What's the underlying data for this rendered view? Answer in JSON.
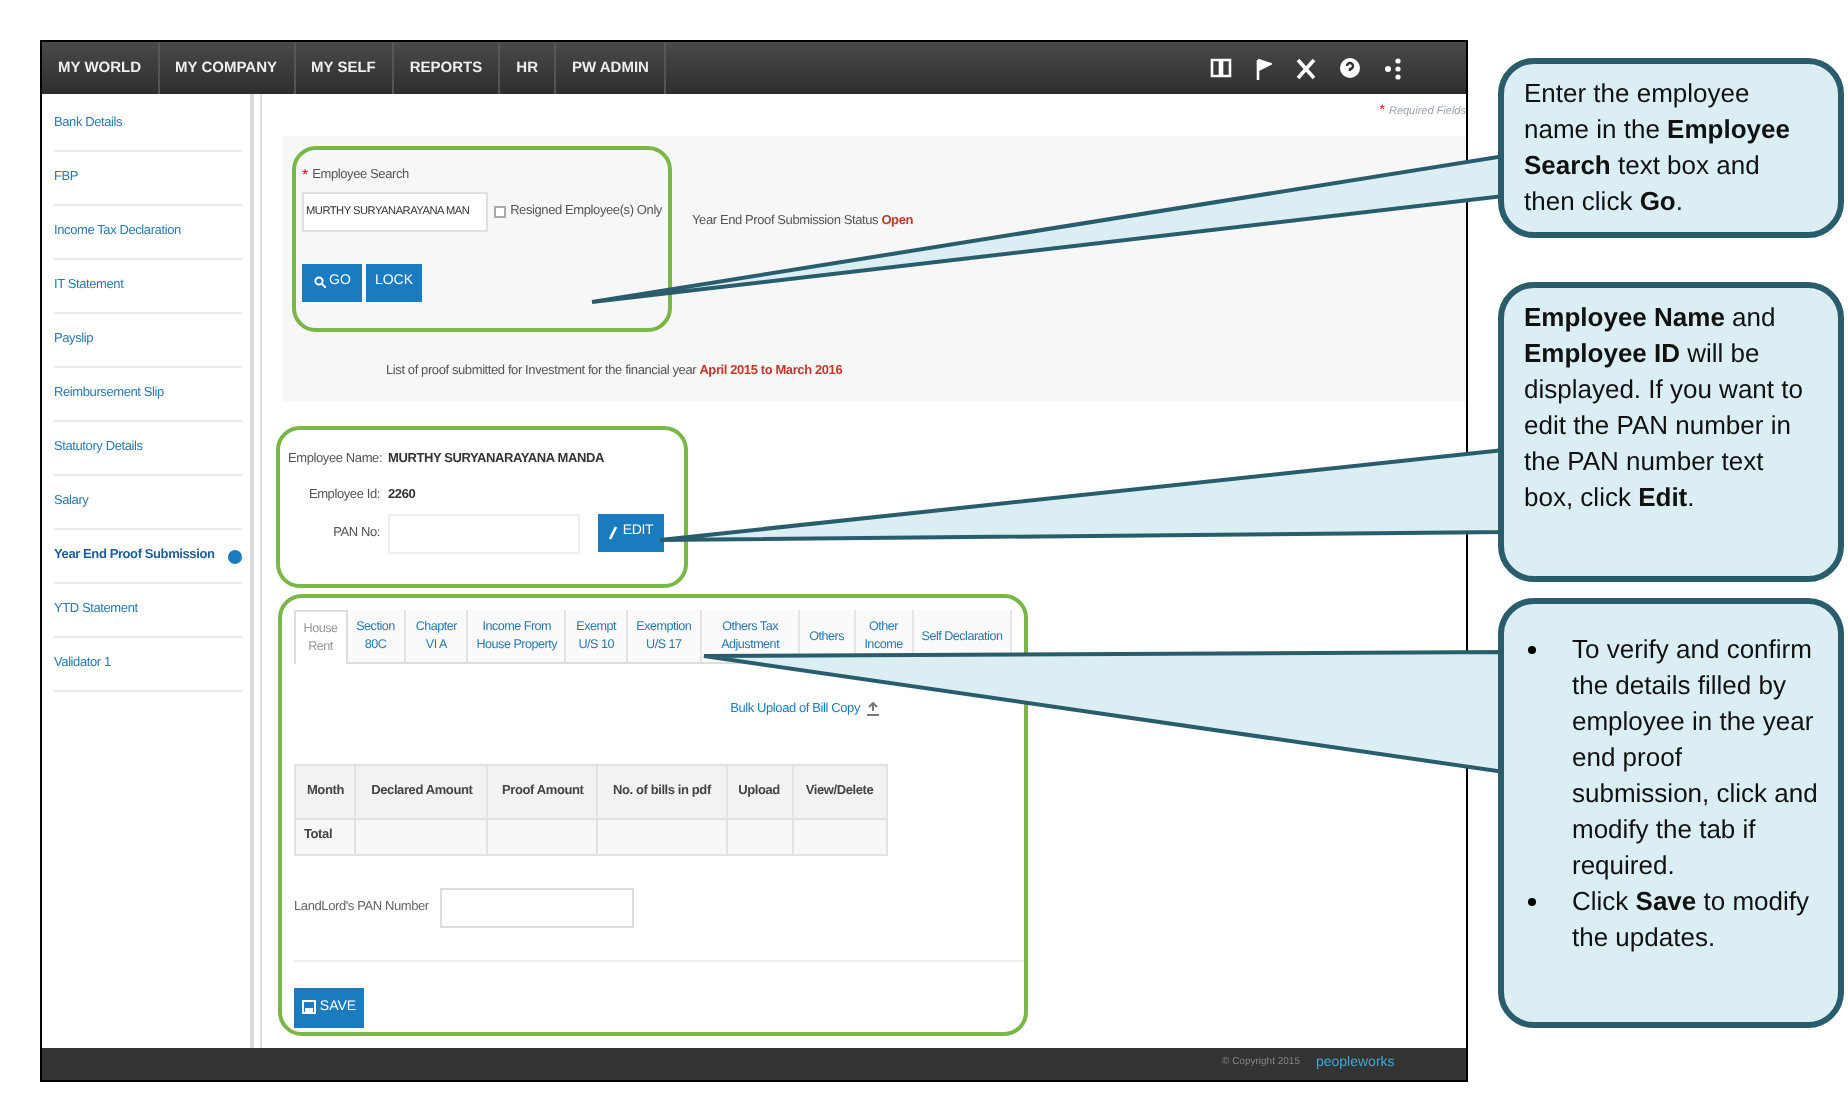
{
  "nav": {
    "items": [
      {
        "label": "MY WORLD",
        "selected": false
      },
      {
        "label": "MY COMPANY",
        "selected": false
      },
      {
        "label": "MY SELF",
        "selected": false
      },
      {
        "label": "REPORTS",
        "selected": false
      },
      {
        "label": "HR",
        "selected": false
      },
      {
        "label": "PW ADMIN",
        "selected": false
      }
    ]
  },
  "sidebar": {
    "items": [
      {
        "label": "Bank Details",
        "selected": false
      },
      {
        "label": "FBP",
        "selected": false
      },
      {
        "label": "Income Tax Declaration",
        "selected": false
      },
      {
        "label": "IT Statement",
        "selected": false
      },
      {
        "label": "Payslip",
        "selected": false
      },
      {
        "label": "Reimbursement Slip",
        "selected": false
      },
      {
        "label": "Statutory Details",
        "selected": false
      },
      {
        "label": "Salary",
        "selected": false
      },
      {
        "label": "Year End Proof Submission",
        "selected": true
      },
      {
        "label": "YTD Statement",
        "selected": false
      },
      {
        "label": "Validator 1",
        "selected": false
      }
    ]
  },
  "required_note": {
    "mark": "*",
    "text": "Required Fields"
  },
  "search": {
    "required_mark": "*",
    "label": "Employee Search",
    "value": "MURTHY SURYANARAYANA MAN",
    "resigned": {
      "label": "Resigned Employee(s) Only",
      "checked": false
    },
    "status_label": "Year End Proof Submission Status",
    "status_value": "Open",
    "buttons": [
      "GO",
      "LOCK"
    ],
    "note": "List of proof submitted for Investment for the financial year **April 2015 to March 2016**"
  },
  "employee": {
    "name_label": "Employee Name:",
    "name": "MURTHY SURYANARAYANA MANDA",
    "id_label": "Employee Id:",
    "id": "2260",
    "pan_label": "PAN No:",
    "edit_button": "EDIT"
  },
  "tabs": [
    {
      "label": "House Rent",
      "selected": true
    },
    {
      "label": "Section 80C",
      "selected": false
    },
    {
      "label": "Chapter VI A",
      "selected": false
    },
    {
      "label": "Income From House Property",
      "selected": false
    },
    {
      "label": "Exempt U/S 10",
      "selected": false
    },
    {
      "label": "Exemption U/S 17",
      "selected": false
    },
    {
      "label": "Others Tax Adjustment",
      "selected": false
    },
    {
      "label": "Others",
      "selected": false
    },
    {
      "label": "Other Income",
      "selected": false
    },
    {
      "label": "Self Declaration",
      "selected": false
    }
  ],
  "bulk_upload": "Bulk Upload of Bill Copy",
  "table": {
    "columns": [
      "Month",
      "Declared Amount",
      "Proof Amount",
      "No. of bills in pdf",
      "Upload",
      "View/Delete"
    ],
    "rows": [
      [
        "Total"
      ]
    ]
  },
  "landlord_pan_label": "LandLord's PAN Number",
  "save_button": "SAVE",
  "footer": {
    "copyright": "© Copyright 2015",
    "logo": "peopleworks"
  },
  "callouts": [
    {
      "kind": "text",
      "text": "Enter the employee name in the **Employee Search** text box and then click **Go**."
    },
    {
      "kind": "text",
      "text": "**Employee Name** and **Employee ID** will be displayed. If you want to edit the PAN number in the PAN number text box, click **Edit**."
    },
    {
      "kind": "bullets",
      "items": [
        "To verify and confirm the details filled by employee in the year end proof submission, click and modify the tab if required.",
        "Click **Save** to modify the updates."
      ]
    }
  ]
}
